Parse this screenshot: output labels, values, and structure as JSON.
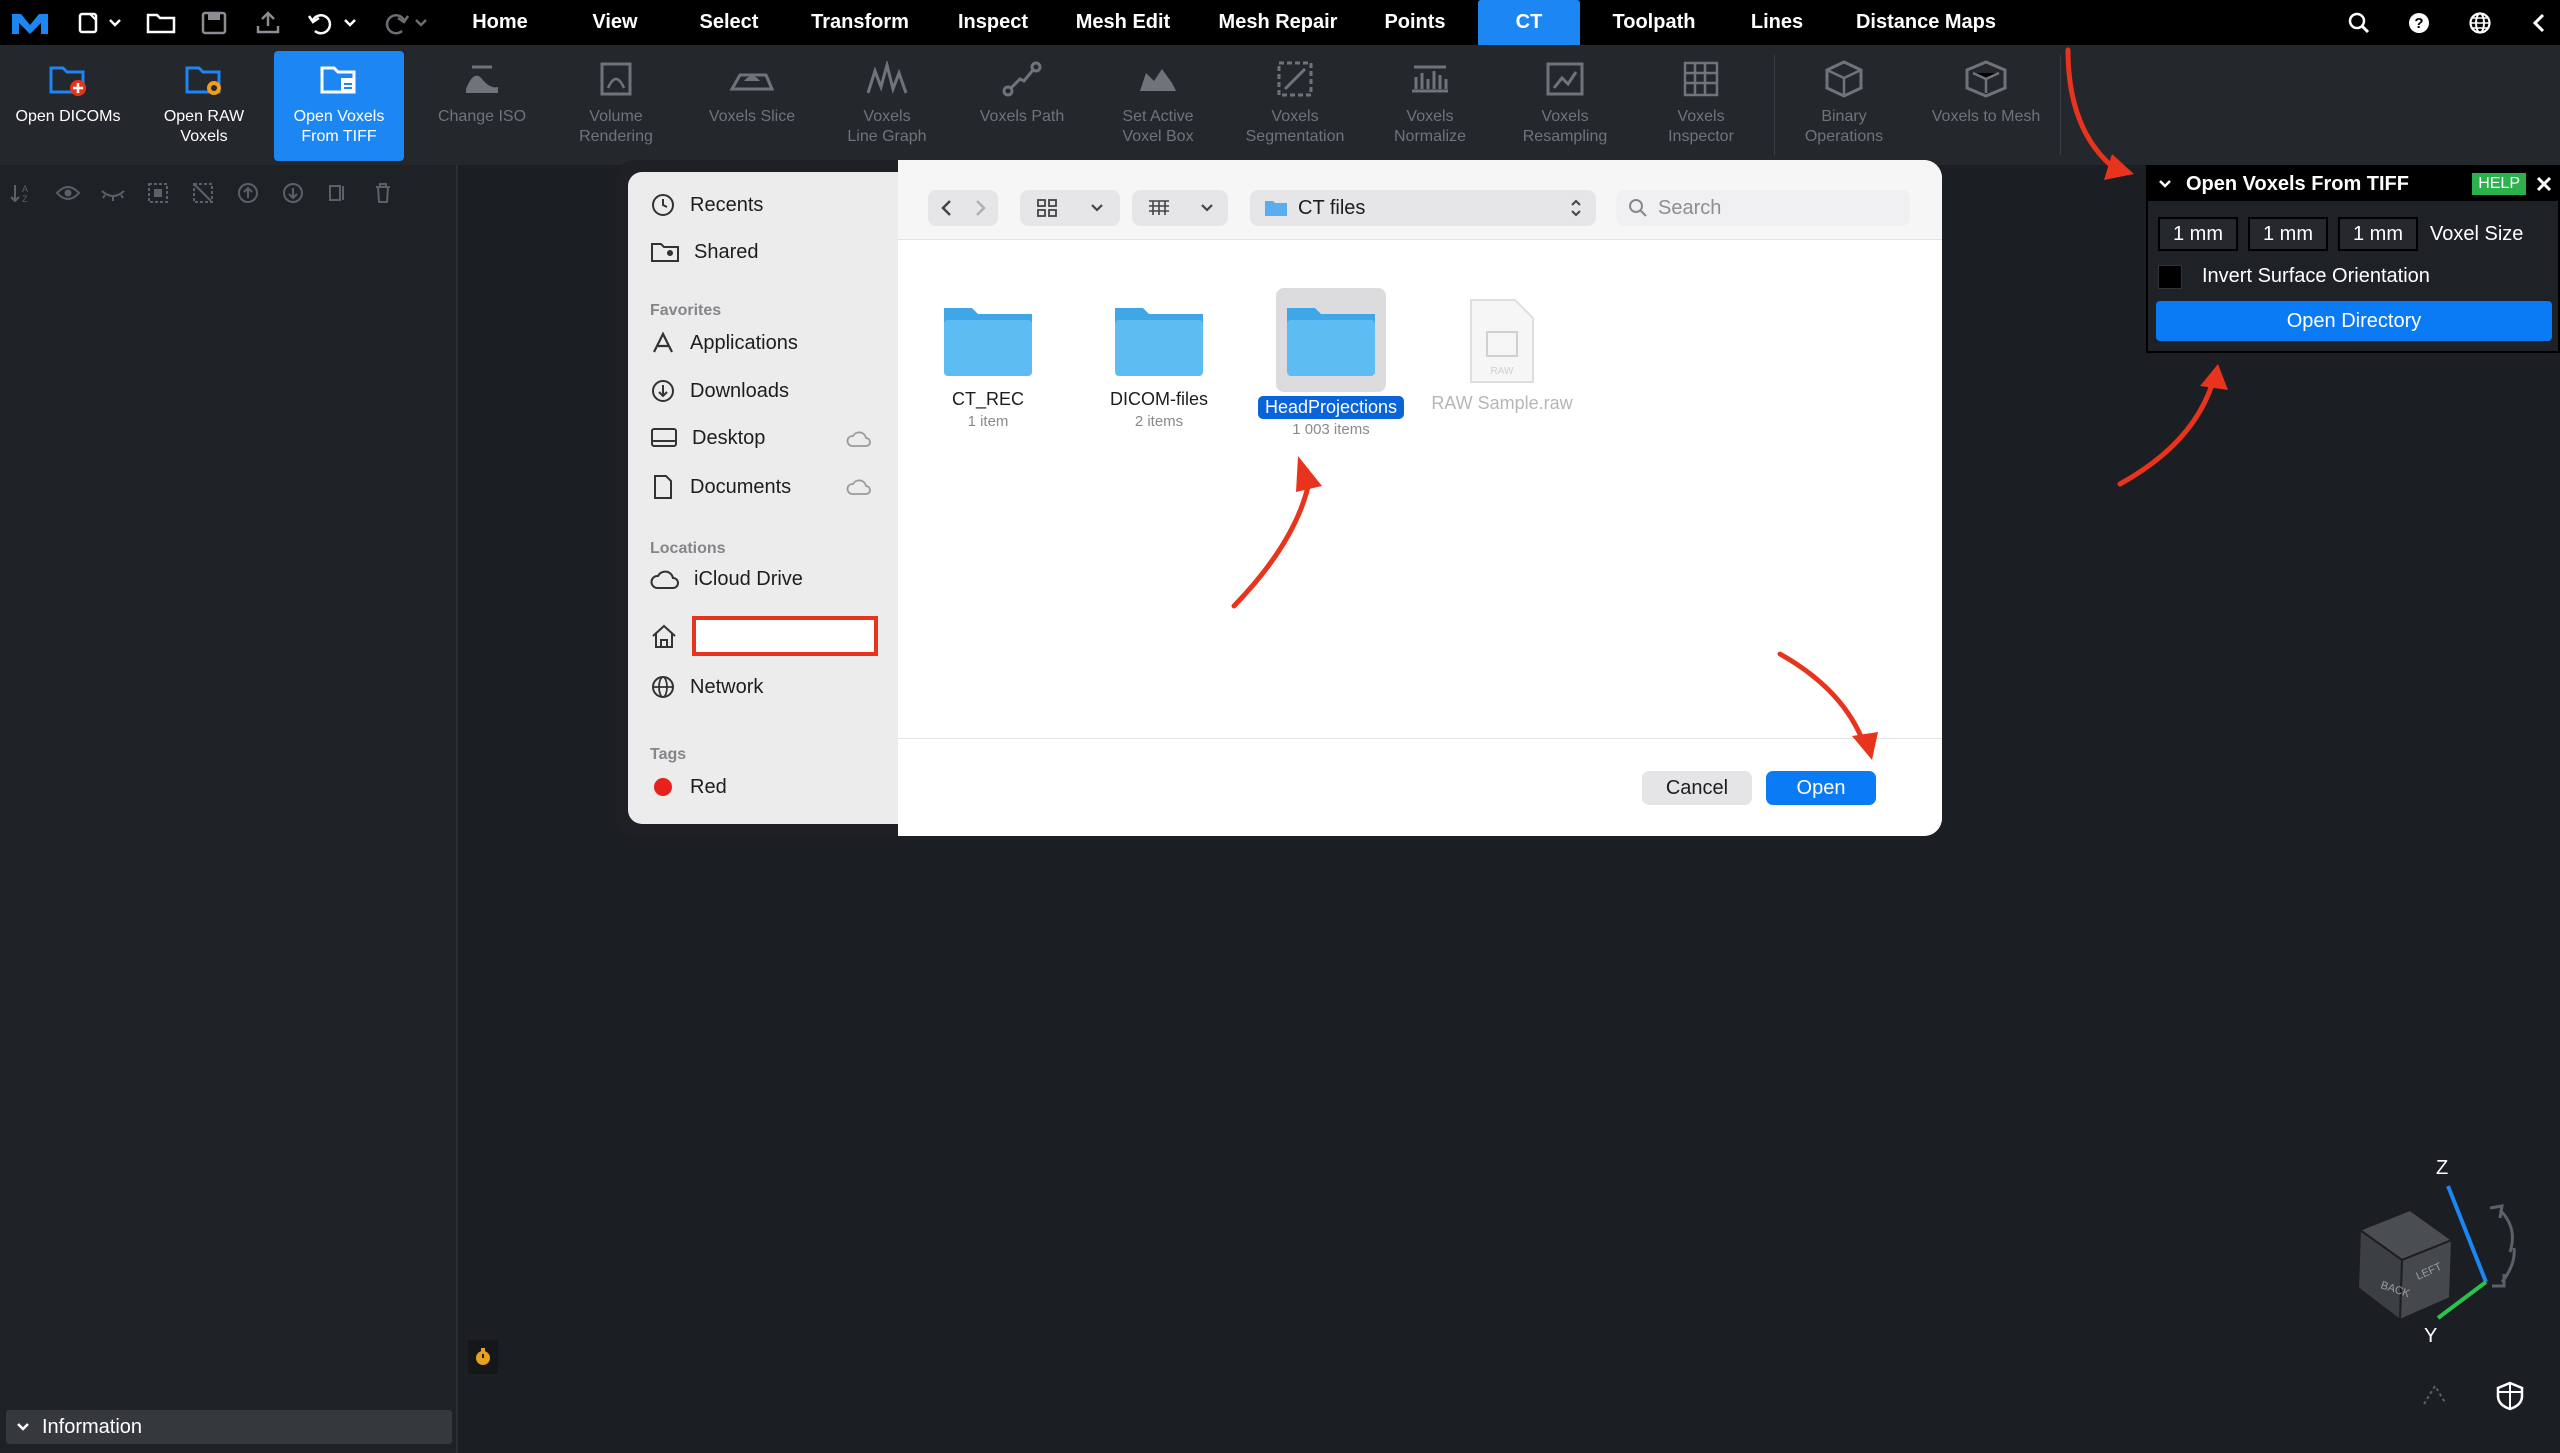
{
  "menubar": {
    "tabs": [
      {
        "label": "Home"
      },
      {
        "label": "View"
      },
      {
        "label": "Select"
      },
      {
        "label": "Transform"
      },
      {
        "label": "Inspect"
      },
      {
        "label": "Mesh Edit"
      },
      {
        "label": "Mesh Repair"
      },
      {
        "label": "Points"
      },
      {
        "label": "CT",
        "active": true
      },
      {
        "label": "Toolpath"
      },
      {
        "label": "Lines"
      },
      {
        "label": "Distance Maps"
      }
    ],
    "right_icons": [
      "search-icon",
      "help-icon",
      "globe-icon",
      "collapse-chevron-icon"
    ]
  },
  "ribbon": {
    "buttons": [
      {
        "label": "Open DICOMs",
        "icon": "folder-plus-icon",
        "enabled": true
      },
      {
        "label": "Open RAW\nVoxels",
        "icon": "folder-raw-icon",
        "enabled": true
      },
      {
        "label": "Open Voxels\nFrom TIFF",
        "icon": "folder-tiff-icon",
        "enabled": true,
        "active": true
      },
      {
        "label": "Change ISO",
        "icon": "iso-icon",
        "enabled": false
      },
      {
        "label": "Volume\nRendering",
        "icon": "volume-icon",
        "enabled": false
      },
      {
        "label": "Voxels Slice",
        "icon": "slice-icon",
        "enabled": false
      },
      {
        "label": "Voxels\nLine Graph",
        "icon": "line-graph-icon",
        "enabled": false
      },
      {
        "label": "Voxels Path",
        "icon": "path-icon",
        "enabled": false
      },
      {
        "label": "Set Active\nVoxel Box",
        "icon": "voxel-box-icon",
        "enabled": false
      },
      {
        "label": "Voxels\nSegmentation",
        "icon": "segmentation-icon",
        "enabled": false
      },
      {
        "label": "Voxels\nNormalize",
        "icon": "normalize-icon",
        "enabled": false
      },
      {
        "label": "Voxels\nResampling",
        "icon": "resampling-icon",
        "enabled": false
      },
      {
        "label": "Voxels\nInspector",
        "icon": "inspector-icon",
        "enabled": false
      },
      {
        "label": "Binary\nOperations",
        "icon": "binary-icon",
        "enabled": false
      },
      {
        "label": "Voxels to Mesh",
        "icon": "voxels-to-mesh-icon",
        "enabled": false
      }
    ]
  },
  "left_panel": {
    "info_label": "Information"
  },
  "dialog": {
    "sidebar": {
      "recents": "Recents",
      "shared": "Shared",
      "favorites_header": "Favorites",
      "applications": "Applications",
      "downloads": "Downloads",
      "desktop": "Desktop",
      "documents": "Documents",
      "locations_header": "Locations",
      "icloud": "iCloud Drive",
      "network": "Network",
      "tags_header": "Tags",
      "tag_red": "Red"
    },
    "location": "CT files",
    "search_placeholder": "Search",
    "files": [
      {
        "name": "CT_REC",
        "count": "1 item",
        "kind": "folder"
      },
      {
        "name": "DICOM-files",
        "count": "2 items",
        "kind": "folder"
      },
      {
        "name": "HeadProjections",
        "count": "1 003 items",
        "kind": "folder",
        "selected": true
      },
      {
        "name": "RAW Sample.raw",
        "count": "",
        "kind": "file",
        "disabled": true
      }
    ],
    "raw_badge": "RAW",
    "cancel": "Cancel",
    "open": "Open"
  },
  "panel": {
    "title": "Open Voxels From TIFF",
    "help": "HELP",
    "voxel_x": "1 mm",
    "voxel_y": "1 mm",
    "voxel_z": "1 mm",
    "voxel_size_label": "Voxel Size",
    "invert_label": "Invert Surface Orientation",
    "invert_checked": false,
    "open_directory": "Open Directory"
  },
  "view_cube": {
    "z": "Z",
    "y": "Y",
    "back": "BACK",
    "left": "LEFT"
  },
  "colors": {
    "accent": "#1c86f2",
    "annotation": "#e8341c",
    "help_badge": "#2bb24c"
  }
}
